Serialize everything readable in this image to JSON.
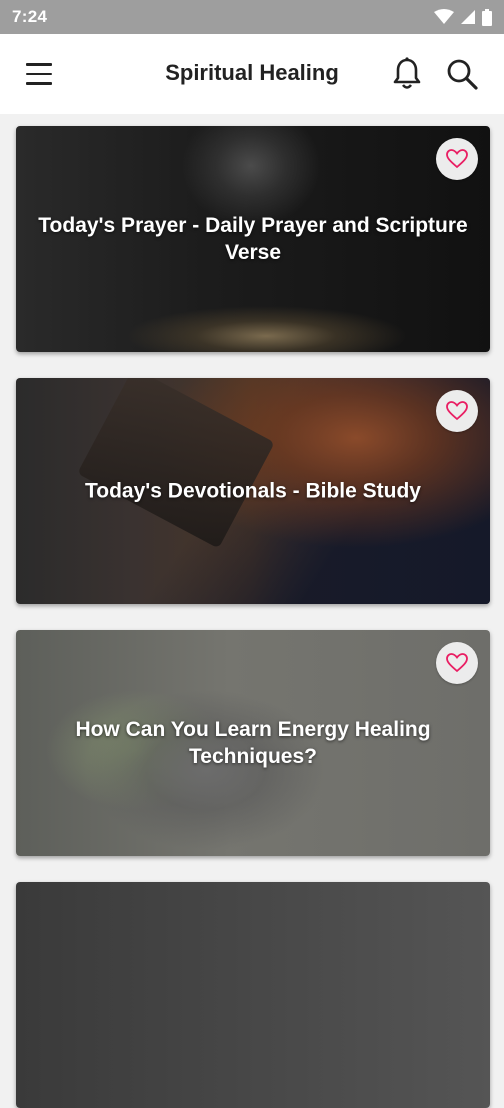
{
  "status_bar": {
    "time": "7:24"
  },
  "app_bar": {
    "title": "Spiritual Healing"
  },
  "cards": [
    {
      "title": "Today's Prayer - Daily Prayer and Scripture Verse"
    },
    {
      "title": "Today's Devotionals - Bible Study"
    },
    {
      "title": "How Can You Learn Energy Healing Techniques?"
    },
    {
      "title": ""
    }
  ],
  "colors": {
    "status_bar": "#9e9e9e",
    "app_bar": "#ffffff",
    "heart": "#e91e63",
    "fav_bg": "#ececec"
  },
  "icons": [
    "menu-icon",
    "bell-icon",
    "search-icon",
    "heart-icon",
    "wifi-icon",
    "signal-icon",
    "battery-icon"
  ]
}
